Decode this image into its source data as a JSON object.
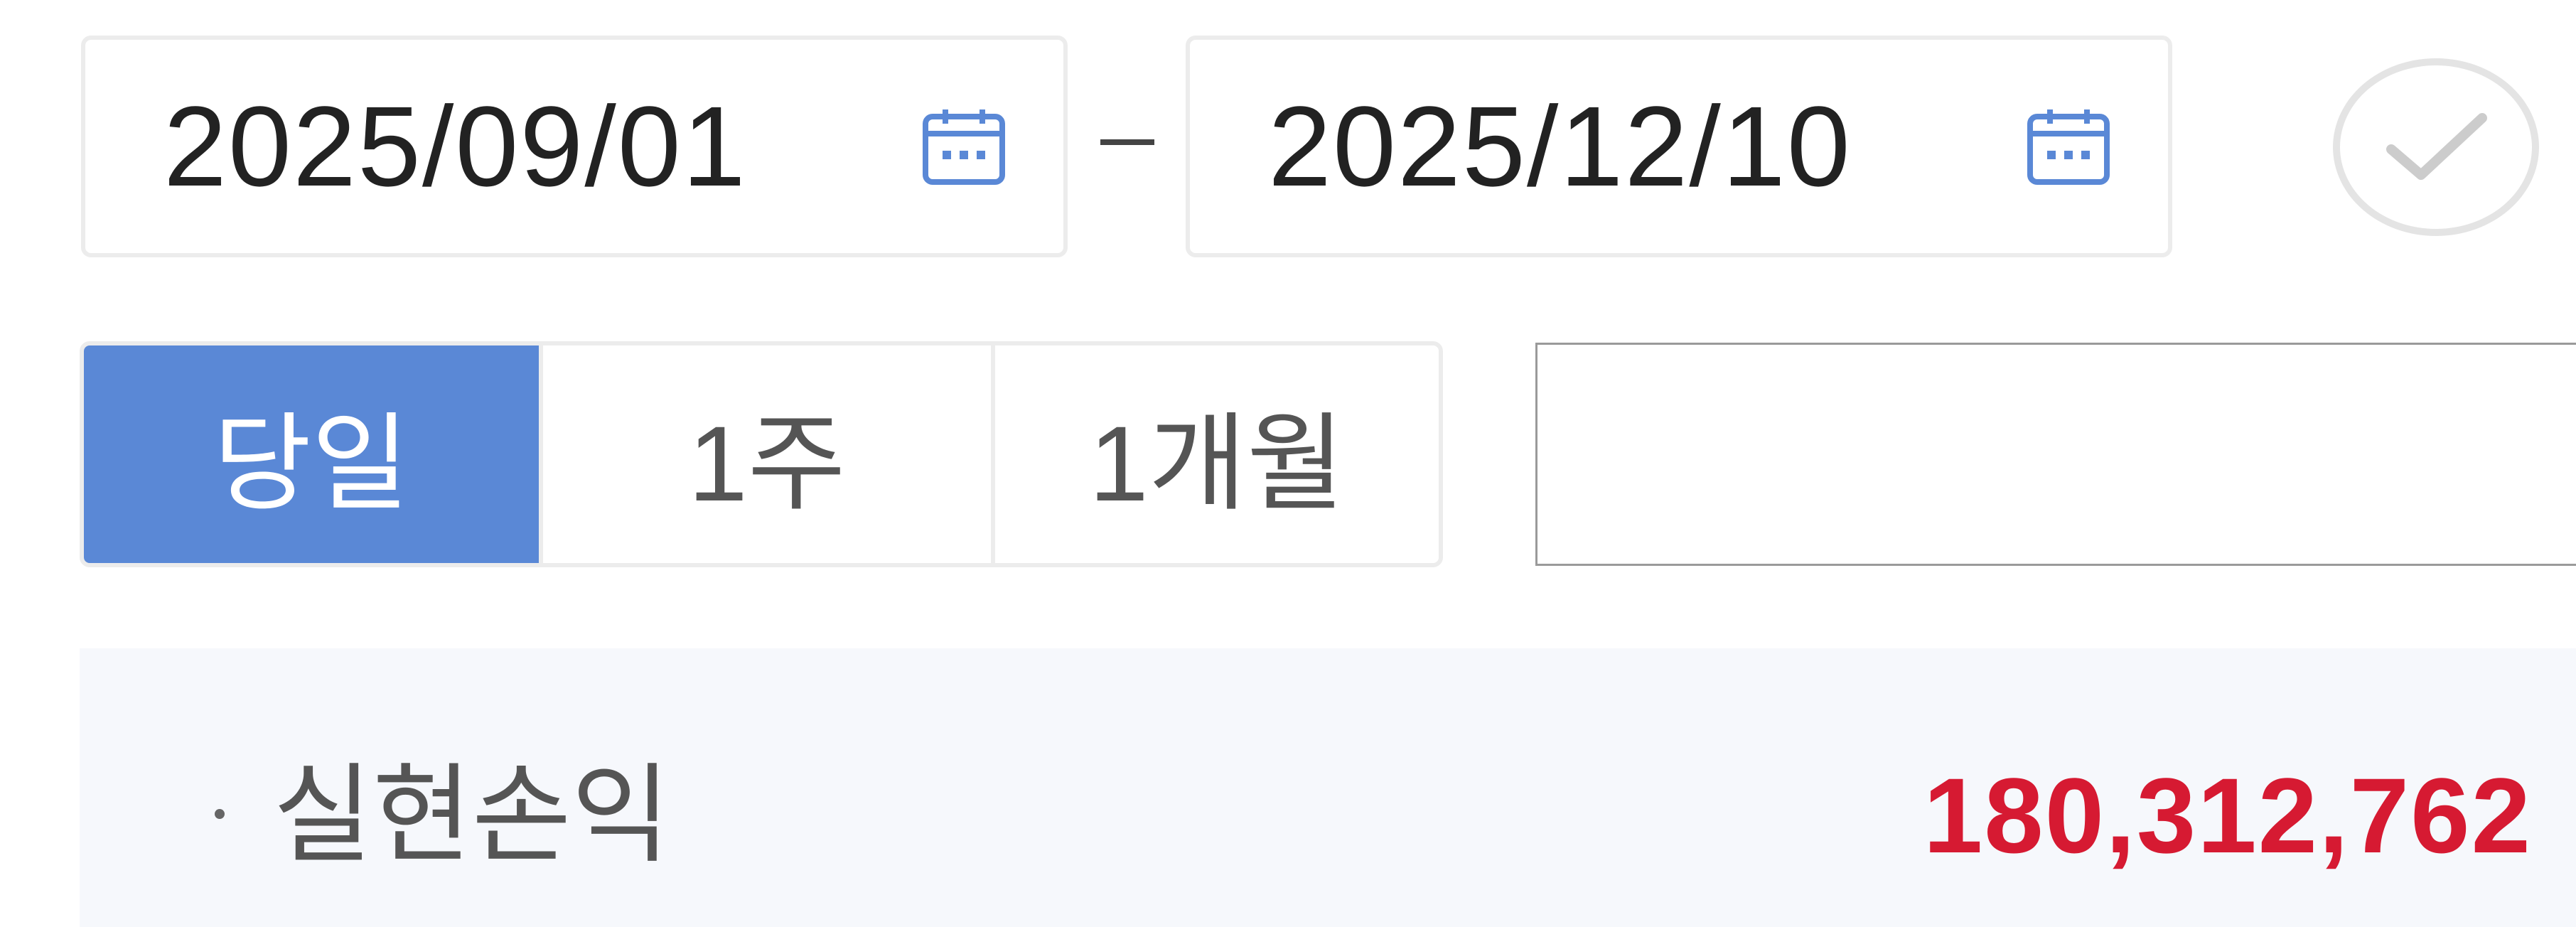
{
  "date_range": {
    "start": "2025/09/01",
    "end": "2025/12/10",
    "separator_icon": "dash",
    "start_icon": "calendar-icon",
    "end_icon": "calendar-icon",
    "confirm_icon": "check-icon"
  },
  "period_buttons": [
    {
      "label": "당일",
      "active": true
    },
    {
      "label": "1주",
      "active": false
    },
    {
      "label": "1개월",
      "active": false
    }
  ],
  "extra_input": {
    "value": ""
  },
  "summary": {
    "label": "실현손익",
    "value": "180,312,762"
  },
  "colors": {
    "accent": "#5a88d6",
    "profit": "#d61a32",
    "panel_bg": "#f6f8fc",
    "border": "#ececec"
  }
}
